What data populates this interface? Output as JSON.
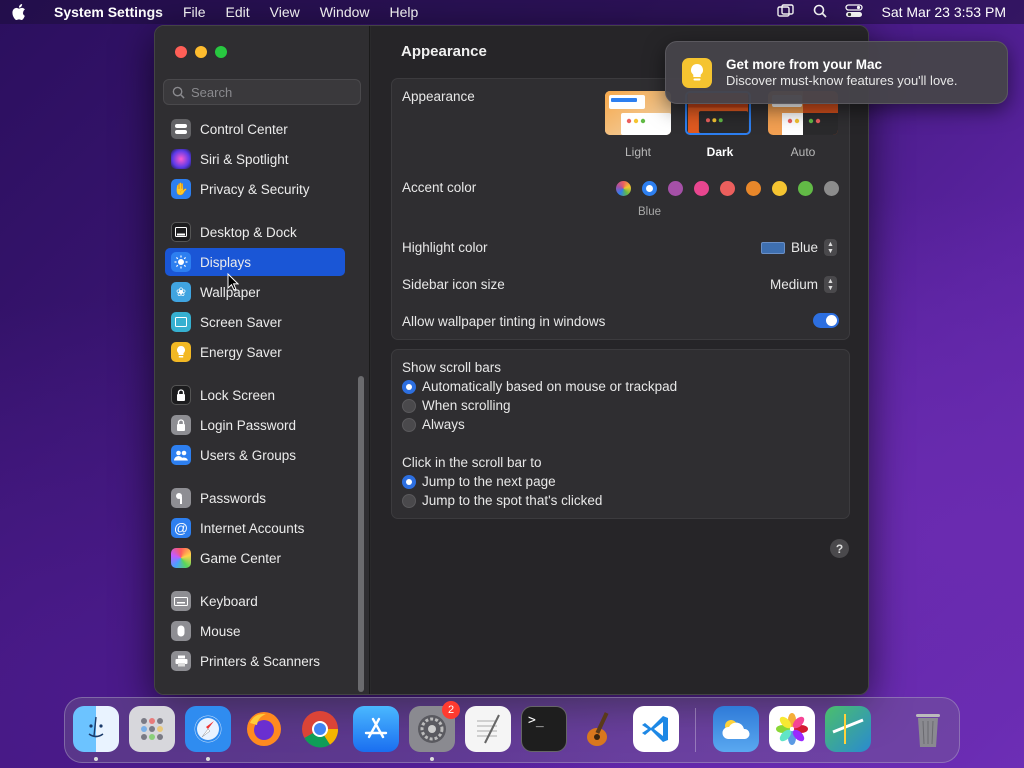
{
  "menubar": {
    "app_name": "System Settings",
    "items": [
      "File",
      "Edit",
      "View",
      "Window",
      "Help"
    ],
    "clock": "Sat Mar 23  3:53 PM"
  },
  "sidebar": {
    "search_placeholder": "Search",
    "items": [
      {
        "label": "Control Center",
        "icon": "control-center-icon",
        "color": "#636366"
      },
      {
        "label": "Siri & Spotlight",
        "icon": "siri-icon",
        "color": "#b03ad8"
      },
      {
        "label": "Privacy & Security",
        "icon": "hand-icon",
        "color": "#2d7ff0"
      },
      {
        "label": "Desktop & Dock",
        "icon": "dock-icon",
        "color": "#1c1c1e"
      },
      {
        "label": "Displays",
        "icon": "sun-icon",
        "color": "#2d7ff0"
      },
      {
        "label": "Wallpaper",
        "icon": "wallpaper-icon",
        "color": "#40a4e0"
      },
      {
        "label": "Screen Saver",
        "icon": "screen-saver-icon",
        "color": "#36b0d0"
      },
      {
        "label": "Energy Saver",
        "icon": "bulb-icon",
        "color": "#f2b824"
      },
      {
        "label": "Lock Screen",
        "icon": "lock-icon",
        "color": "#1c1c1e"
      },
      {
        "label": "Login Password",
        "icon": "lock-icon",
        "color": "#8e8e93"
      },
      {
        "label": "Users & Groups",
        "icon": "users-icon",
        "color": "#2d7ff0"
      },
      {
        "label": "Passwords",
        "icon": "key-icon",
        "color": "#8e8e93"
      },
      {
        "label": "Internet Accounts",
        "icon": "at-icon",
        "color": "#2d7ff0"
      },
      {
        "label": "Game Center",
        "icon": "game-center-icon",
        "color": "#e8e8e8"
      },
      {
        "label": "Keyboard",
        "icon": "keyboard-icon",
        "color": "#8e8e93"
      },
      {
        "label": "Mouse",
        "icon": "mouse-icon",
        "color": "#8e8e93"
      },
      {
        "label": "Printers & Scanners",
        "icon": "printer-icon",
        "color": "#8e8e93"
      }
    ],
    "selected": "Displays"
  },
  "content": {
    "title": "Appearance",
    "appearance": {
      "label": "Appearance",
      "options": [
        "Light",
        "Dark",
        "Auto"
      ],
      "selected": "Dark"
    },
    "accent": {
      "label": "Accent color",
      "colors": [
        "multicolor",
        "#2d7ff0",
        "#a550a7",
        "#e8468f",
        "#ec5f5d",
        "#e8872a",
        "#f5c431",
        "#62ba46",
        "#8c8c8c"
      ],
      "selected_index": 1,
      "caption": "Blue"
    },
    "highlight": {
      "label": "Highlight color",
      "value": "Blue"
    },
    "icon_size": {
      "label": "Sidebar icon size",
      "value": "Medium"
    },
    "tinting": {
      "label": "Allow wallpaper tinting in windows",
      "on": true
    },
    "scroll_bars": {
      "label": "Show scroll bars",
      "options": [
        "Automatically based on mouse or trackpad",
        "When scrolling",
        "Always"
      ],
      "selected_index": 0
    },
    "click_scroll": {
      "label": "Click in the scroll bar to",
      "options": [
        "Jump to the next page",
        "Jump to the spot that's clicked"
      ],
      "selected_index": 0
    },
    "help": "?"
  },
  "notification": {
    "title": "Get more from your Mac",
    "body": "Discover must-know features you'll love."
  },
  "dock": {
    "apps": [
      "Finder",
      "Launchpad",
      "Safari",
      "Firefox",
      "Chrome",
      "App Store",
      "System Settings",
      "TextEdit",
      "Terminal",
      "GarageBand",
      "VS Code",
      "Weather",
      "Photos",
      "Maps",
      "Trash"
    ],
    "settings_badge": "2"
  }
}
